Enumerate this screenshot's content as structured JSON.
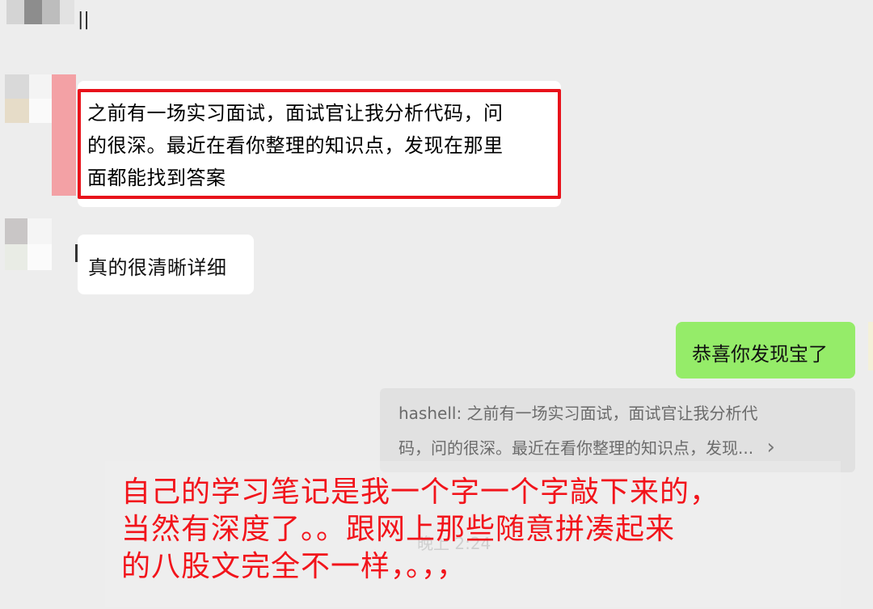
{
  "chat": {
    "top_bar_mark": "||",
    "messages": [
      {
        "sender": "friend",
        "lines": [
          "之前有一场实习面试，面试官让我分析代码，问",
          "的很深。最近在看你整理的知识点，发现在那里",
          "面都能找到答案"
        ]
      },
      {
        "sender": "friend",
        "text": "真的很清晰详细"
      },
      {
        "sender": "me",
        "text": "恭喜你发现宝了"
      }
    ],
    "quote": {
      "line1": "hashell: 之前有一场实习面试，面试官让我分析代",
      "line2": "码，问的很深。最近在看你整理的知识点，发现...",
      "chevron": "›"
    },
    "timestamp_partial": "晚上 2:24"
  },
  "annotation": {
    "lines": [
      "自己的学习笔记是我一个字一个字敲下来的，",
      "当然有深度了。。跟网上那些随意拼凑起来",
      "的八股文完全不一样，。，，"
    ],
    "color": "#f2141b"
  },
  "colors": {
    "background": "#ededed",
    "bubble_me": "#95ec69",
    "highlight_box": "#e8121b"
  }
}
